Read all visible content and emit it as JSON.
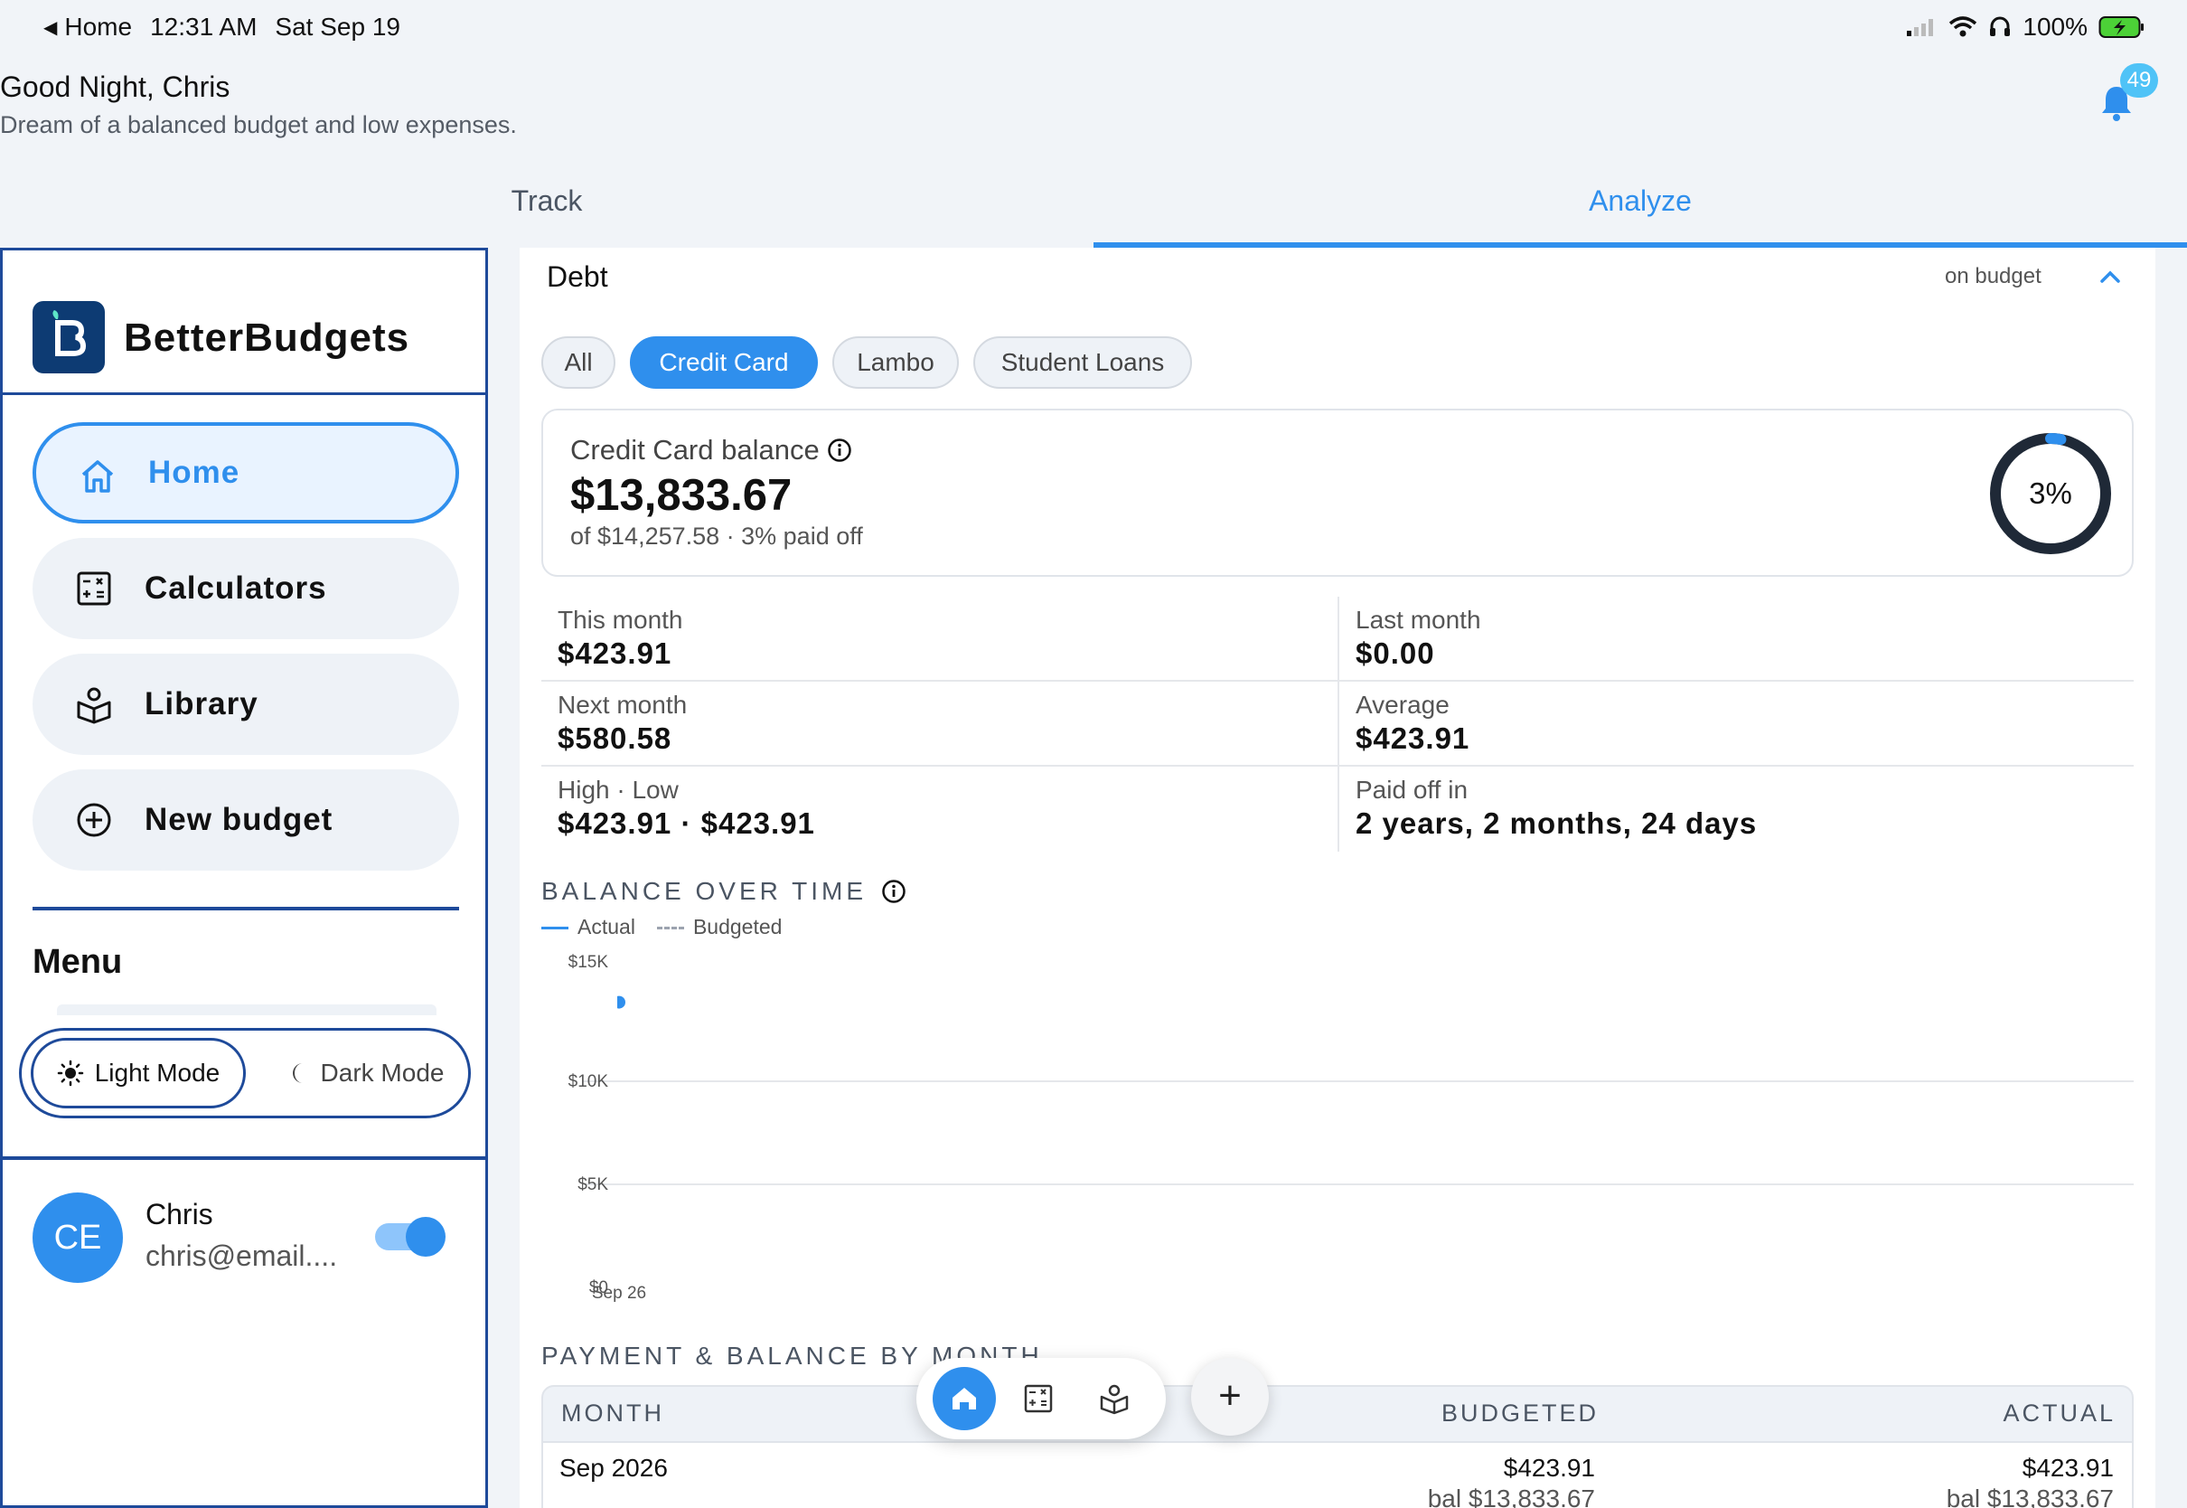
{
  "status_bar": {
    "back_app": "Home",
    "time": "12:31 AM",
    "date": "Sat Sep 19",
    "battery": "100%"
  },
  "greeting": {
    "title": "Good Night, Chris",
    "subtitle": "Dream of a balanced budget and low expenses."
  },
  "notifications": {
    "count": "49"
  },
  "tabs": {
    "track": "Track",
    "analyze": "Analyze"
  },
  "sidebar": {
    "brand": "BetterBudgets",
    "nav": [
      {
        "label": "Home"
      },
      {
        "label": "Calculators"
      },
      {
        "label": "Library"
      },
      {
        "label": "New budget"
      }
    ],
    "menu_title": "Menu",
    "modes": {
      "light": "Light Mode",
      "dark": "Dark Mode"
    },
    "user": {
      "initials": "CE",
      "name": "Chris",
      "email": "chris@email...."
    }
  },
  "debt": {
    "title": "Debt",
    "status": "on budget",
    "filters": [
      "All",
      "Credit Card",
      "Lambo",
      "Student Loans"
    ],
    "selected_filter": "Credit Card",
    "balance": {
      "label": "Credit Card balance",
      "amount": "$13,833.67",
      "subtitle": "of $14,257.58 · 3% paid off",
      "percent_label": "3%",
      "percent": 3
    },
    "stats": [
      {
        "k": "This month",
        "v": "$423.91"
      },
      {
        "k": "Last month",
        "v": "$0.00"
      },
      {
        "k": "Next month",
        "v": "$580.58"
      },
      {
        "k": "Average",
        "v": "$423.91"
      },
      {
        "k": "High · Low",
        "v": "$423.91 · $423.91"
      },
      {
        "k": "Paid off in",
        "v": "2 years, 2 months, 24 days"
      }
    ]
  },
  "balance_chart": {
    "section_title": "BALANCE OVER TIME",
    "legend_actual": "Actual",
    "legend_budgeted": "Budgeted",
    "colors": {
      "actual": "#2f8fed",
      "budgeted": "#9ca3af"
    }
  },
  "chart_data": {
    "type": "line",
    "title": "BALANCE OVER TIME",
    "x": [
      "Sep 26"
    ],
    "y_ticks": [
      "$15K",
      "$10K",
      "$5K",
      "$0"
    ],
    "ylim": [
      0,
      15000
    ],
    "series": [
      {
        "name": "Actual",
        "values": [
          13833.67
        ]
      },
      {
        "name": "Budgeted",
        "values": []
      }
    ],
    "legend": "top-left",
    "grid": true
  },
  "payment_table": {
    "section_title": "PAYMENT & BALANCE BY MONTH",
    "headers": {
      "month": "MONTH",
      "budgeted": "BUDGETED",
      "actual": "ACTUAL"
    },
    "rows": [
      {
        "month": "Sep 2026",
        "budgeted": "$423.91",
        "budgeted_bal": "bal $13,833.67",
        "actual": "$423.91",
        "actual_bal": "bal $13,833.67"
      }
    ]
  },
  "dock": {
    "add_label": "+"
  }
}
